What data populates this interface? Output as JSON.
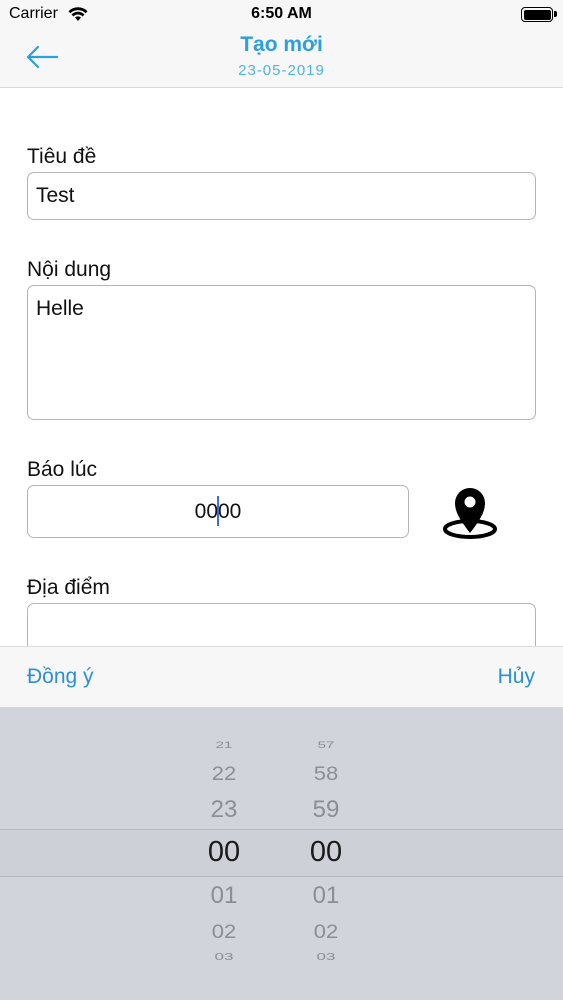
{
  "status": {
    "carrier": "Carrier",
    "time": "6:50 AM"
  },
  "nav": {
    "title": "Tạo mới",
    "subtitle": "23-05-2019"
  },
  "form": {
    "title_label": "Tiêu đề",
    "title_value": "Test",
    "content_label": "Nội dung",
    "content_value": "Helle",
    "alarm_label": "Báo lúc",
    "alarm_hour": "00",
    "alarm_minute": "00",
    "place_label": "Địa điểm",
    "place_value": ""
  },
  "picker_toolbar": {
    "ok": "Đồng ý",
    "cancel": "Hủy"
  },
  "picker": {
    "hours": [
      "21",
      "22",
      "23",
      "00",
      "01",
      "02",
      "03"
    ],
    "minutes": [
      "57",
      "58",
      "59",
      "00",
      "01",
      "02",
      "03"
    ],
    "selected_hour": "00",
    "selected_minute": "00"
  },
  "colors": {
    "accent": "#2d9fde",
    "link": "#2d8fd5",
    "picker_bg": "#d1d4da"
  },
  "icons": [
    "wifi-icon",
    "battery-icon",
    "back-arrow-icon",
    "location-pin-icon"
  ]
}
